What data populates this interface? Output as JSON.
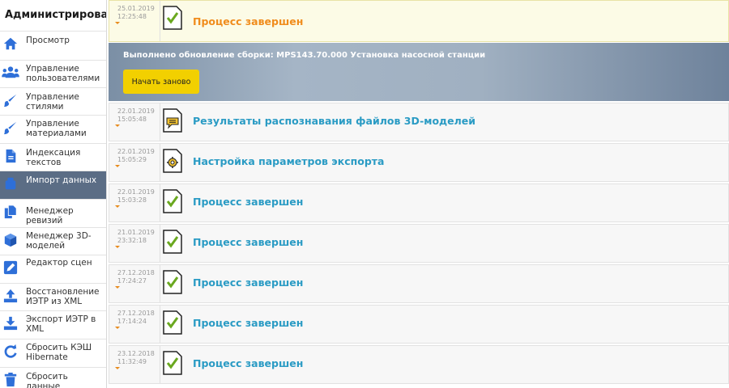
{
  "sidebar": {
    "title": "Администрирование",
    "items": [
      {
        "label": "Просмотр",
        "icon": "home-icon"
      },
      {
        "label": "Управление пользователями",
        "icon": "users-icon"
      },
      {
        "label": "Управление стилями",
        "icon": "brush-icon"
      },
      {
        "label": "Управление материалами",
        "icon": "brush-icon"
      },
      {
        "label": "Индексация текстов",
        "icon": "document-icon"
      },
      {
        "label": "Импорт данных",
        "icon": "import-icon"
      },
      {
        "label": "Менеджер ревизий",
        "icon": "copy-icon"
      },
      {
        "label": "Менеджер 3D-моделей",
        "icon": "cube-icon"
      },
      {
        "label": "Редактор сцен",
        "icon": "edit-icon"
      },
      {
        "label": "Восстановление ИЭТР из XML",
        "icon": "upload-icon"
      },
      {
        "label": "Экспорт ИЭТР в XML",
        "icon": "download-icon"
      },
      {
        "label": "Сбросить КЭШ Hibernate",
        "icon": "refresh-icon"
      },
      {
        "label": "Сбросить данные",
        "icon": "trash-icon"
      }
    ],
    "active_index": 5
  },
  "tasks": [
    {
      "date": "25.01.2019",
      "time": "12:25:48",
      "title": "Процесс завершен",
      "icon": "check-document-icon",
      "expanded": true
    },
    {
      "date": "22.01.2019",
      "time": "15:05:48",
      "title": "Результаты распознавания файлов 3D-моделей",
      "icon": "comment-document-icon"
    },
    {
      "date": "22.01.2019",
      "time": "15:05:29",
      "title": "Настройка параметров экспорта",
      "icon": "gear-document-icon"
    },
    {
      "date": "22.01.2019",
      "time": "15:03:28",
      "title": "Процесс завершен",
      "icon": "check-document-icon"
    },
    {
      "date": "21.01.2019",
      "time": "23:32:18",
      "title": "Процесс завершен",
      "icon": "check-document-icon"
    },
    {
      "date": "27.12.2018",
      "time": "17:24:27",
      "title": "Процесс завершен",
      "icon": "check-document-icon"
    },
    {
      "date": "27.12.2018",
      "time": "17:14:24",
      "title": "Процесс завершен",
      "icon": "check-document-icon"
    },
    {
      "date": "23.12.2018",
      "time": "11:32:49",
      "title": "Процесс завершен",
      "icon": "check-document-icon"
    }
  ],
  "detail": {
    "message": "Выполнено обновление сборки: MPS143.70.000 Установка насосной станции",
    "restart_label": "Начать заново"
  },
  "colors": {
    "accent_blue": "#2a9bc4",
    "accent_orange": "#f08c1c",
    "button_yellow": "#f2d000",
    "active_sidebar": "#5b6d85",
    "icon_blue": "#2e6fd8",
    "check_green": "#6aa81f"
  }
}
